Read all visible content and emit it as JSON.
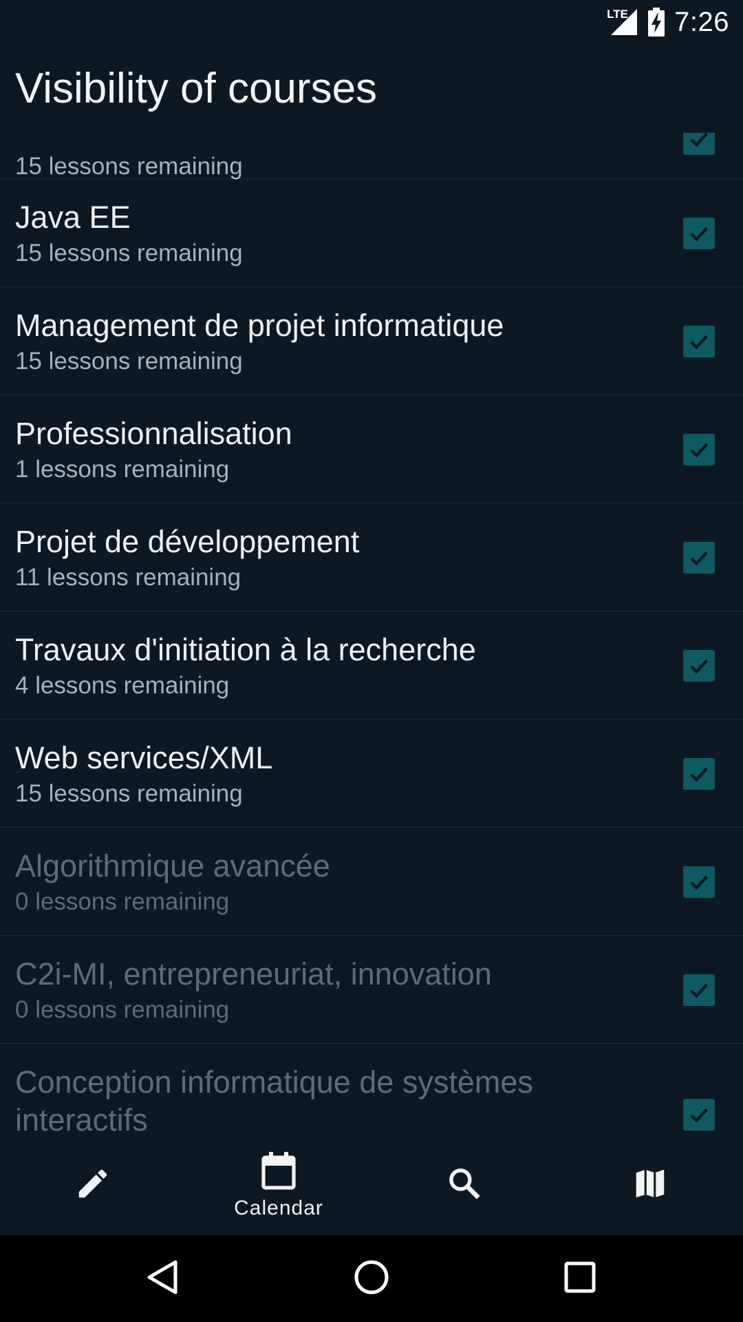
{
  "status_bar": {
    "network_label": "LTE",
    "time": "7:26"
  },
  "app_bar": {
    "title": "Visibility of courses"
  },
  "courses": [
    {
      "name": "",
      "remaining": "15 lessons remaining",
      "checked": true
    },
    {
      "name": "Java EE",
      "remaining": "15 lessons remaining",
      "checked": true
    },
    {
      "name": "Management de projet informatique",
      "remaining": "15 lessons remaining",
      "checked": true
    },
    {
      "name": "Professionnalisation",
      "remaining": "1 lessons remaining",
      "checked": true
    },
    {
      "name": "Projet de développement",
      "remaining": "11 lessons remaining",
      "checked": true
    },
    {
      "name": "Travaux d'initiation à la recherche",
      "remaining": "4 lessons remaining",
      "checked": true
    },
    {
      "name": "Web services/XML",
      "remaining": "15 lessons remaining",
      "checked": true
    },
    {
      "name": "Algorithmique avancée",
      "remaining": "0 lessons remaining",
      "checked": true
    },
    {
      "name": "C2i-MI, entrepreneuriat, innovation",
      "remaining": "0 lessons remaining",
      "checked": true
    },
    {
      "name": "Conception informatique de systèmes interactifs",
      "remaining": "",
      "checked": true
    }
  ],
  "bottom_nav": {
    "items": [
      {
        "icon": "pencil-icon",
        "label": ""
      },
      {
        "icon": "calendar-icon",
        "label": "Calendar"
      },
      {
        "icon": "search-icon",
        "label": ""
      },
      {
        "icon": "map-icon",
        "label": ""
      }
    ]
  },
  "colors": {
    "background": "#0c1923",
    "checkbox": "#0f5a62",
    "text_primary": "#eef0f2",
    "text_secondary": "#a9b1b8",
    "text_disabled": "#5f6b75"
  }
}
